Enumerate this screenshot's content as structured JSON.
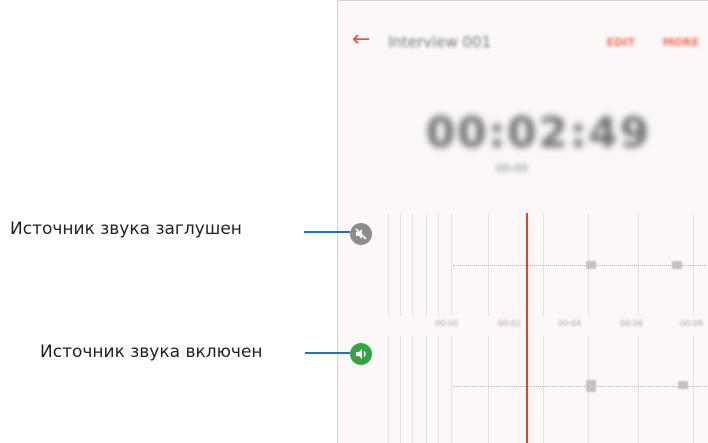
{
  "app": {
    "title": "Interview 001",
    "edit_label": "EDIT",
    "more_label": "MORE",
    "elapsed_time": "00:02:49",
    "total_time": "00:00",
    "accent_color": "#e2573c"
  },
  "timeline": {
    "ticks": [
      "00:00",
      "00:02",
      "00:04",
      "00:06",
      "00:08"
    ]
  },
  "tracks": [
    {
      "state": "muted",
      "icon": "speaker-muted-icon",
      "color": "#8c8c8c"
    },
    {
      "state": "on",
      "icon": "speaker-on-icon",
      "color": "#35a244"
    }
  ],
  "callouts": {
    "muted_label": "Источник звука заглушен",
    "on_label": "Источник звука включен"
  }
}
